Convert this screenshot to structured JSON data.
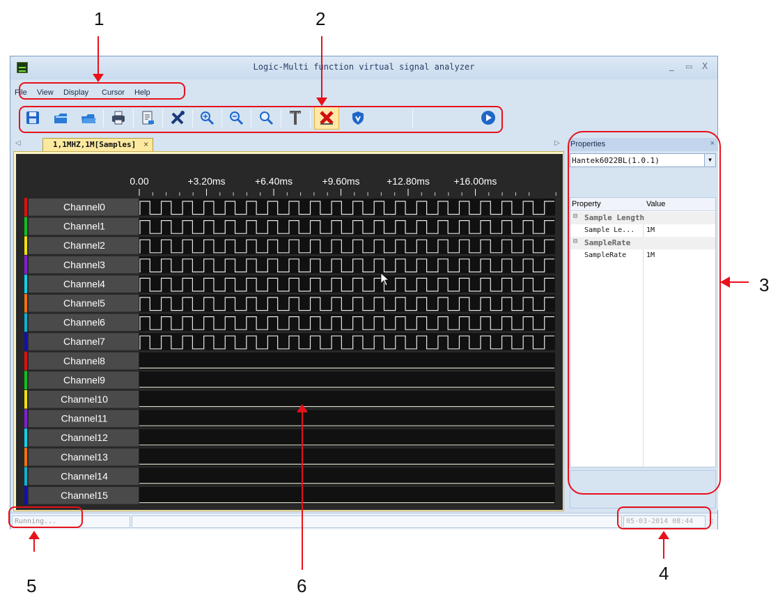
{
  "annotations": [
    "1",
    "2",
    "3",
    "4",
    "5",
    "6"
  ],
  "window": {
    "title": "Logic-Multi function virtual signal analyzer",
    "min_glyph": "_",
    "max_glyph": "▭",
    "close_glyph": "X"
  },
  "menu": [
    "File",
    "View",
    "Display",
    "Cursor",
    "Help"
  ],
  "toolbar": {
    "buttons": [
      {
        "icon": "save-icon",
        "color": "#1f66c9"
      },
      {
        "icon": "open-icon",
        "color": "#2a7ad6"
      },
      {
        "icon": "open-folder-icon",
        "color": "#2a7ad6"
      },
      {
        "icon": "print-icon",
        "color": "#3c4a64"
      },
      {
        "icon": "export-icon",
        "color": "#3c4a64"
      },
      {
        "icon": "settings-tools-icon",
        "color": "#1a3a7a"
      },
      {
        "icon": "zoom-in-icon",
        "color": "#1f66c9"
      },
      {
        "icon": "zoom-out-icon",
        "color": "#1f66c9"
      },
      {
        "icon": "zoom-fit-icon",
        "color": "#1f66c9"
      },
      {
        "icon": "trigger-icon",
        "color": "#555555"
      },
      {
        "icon": "stop-capture-icon",
        "color": "#d01010"
      },
      {
        "icon": "shield-icon",
        "color": "#1f66c9"
      },
      {
        "icon": "run-icon",
        "color": "#1f66c9"
      }
    ]
  },
  "document_tab": {
    "label": "1,1MHZ,1M[Samples]",
    "close_glyph": "×"
  },
  "waveform": {
    "time_ticks": [
      "0.00",
      "+3.20ms",
      "+6.40ms",
      "+9.60ms",
      "+12.80ms",
      "+16.00ms"
    ],
    "active_periods": 19.5,
    "channels": [
      {
        "name": "Channel0",
        "color": "#e01010",
        "active": true
      },
      {
        "name": "Channel1",
        "color": "#10c020",
        "active": true
      },
      {
        "name": "Channel2",
        "color": "#f0e010",
        "active": true
      },
      {
        "name": "Channel3",
        "color": "#8020d0",
        "active": true
      },
      {
        "name": "Channel4",
        "color": "#10d0e8",
        "active": true
      },
      {
        "name": "Channel5",
        "color": "#f07010",
        "active": true
      },
      {
        "name": "Channel6",
        "color": "#10b0d0",
        "active": true
      },
      {
        "name": "Channel7",
        "color": "#1010b0",
        "active": true
      },
      {
        "name": "Channel8",
        "color": "#e01010",
        "active": false
      },
      {
        "name": "Channel9",
        "color": "#10c020",
        "active": false
      },
      {
        "name": "Channel10",
        "color": "#f0e010",
        "active": false
      },
      {
        "name": "Channel11",
        "color": "#8020d0",
        "active": false
      },
      {
        "name": "Channel12",
        "color": "#10d0e8",
        "active": false
      },
      {
        "name": "Channel13",
        "color": "#f07010",
        "active": false
      },
      {
        "name": "Channel14",
        "color": "#10b0d0",
        "active": false
      },
      {
        "name": "Channel15",
        "color": "#1010b0",
        "active": false
      }
    ]
  },
  "properties": {
    "title": "Properties",
    "close_glyph": "×",
    "device": "Hantek6022BL(1.0.1)",
    "columns": [
      "Property",
      "Value"
    ],
    "groups": [
      {
        "name": "Sample Length",
        "items": [
          {
            "name": "Sample Le...",
            "value": "1M"
          }
        ]
      },
      {
        "name": "SampleRate",
        "items": [
          {
            "name": "SampleRate",
            "value": "1M"
          }
        ]
      }
    ]
  },
  "status": {
    "text": "Running...",
    "datetime": "05-03-2014 08:44"
  }
}
